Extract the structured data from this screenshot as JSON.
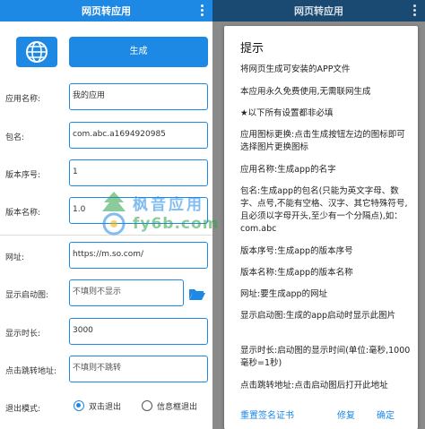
{
  "app": {
    "title": "网页转应用"
  },
  "form": {
    "generate_label": "生成",
    "app_name": {
      "label": "应用名称:",
      "value": "我的应用"
    },
    "package": {
      "label": "包名:",
      "value": "com.abc.a1694920985"
    },
    "version_code": {
      "label": "版本序号:",
      "value": "1"
    },
    "version_name": {
      "label": "版本名称:",
      "value": "1.0"
    },
    "url": {
      "label": "网址:",
      "value": "https://m.so.com/"
    },
    "splash": {
      "label": "显示启动图:",
      "value": "不填则不显示"
    },
    "duration": {
      "label": "显示时长:",
      "value": "3000"
    },
    "click_url": {
      "label": "点击跳转地址:",
      "value": "不填则不跳转"
    },
    "exit": {
      "label": "退出模式:",
      "options": [
        "双击退出",
        "信息框退出"
      ],
      "selected": "双击退出"
    }
  },
  "dialog": {
    "title": "提示",
    "paragraphs": [
      "将网页生成可安装的APP文件",
      "本应用永久免费使用,无需联网生成",
      "★以下所有设置都非必填",
      "应用图标更换:点击生成按钮左边的图标即可选择图片更换图标",
      "应用名称:生成app的名字",
      "包名:生成app的包名(只能为英文字母、数字、点号,不能有空格、汉字、其它特殊符号,且必须以字母开头,至少有一个分隔点),如：com.abc",
      "版本序号:生成app的版本序号",
      "版本名称:生成app的版本名称",
      "网址:要生成app的网址",
      "显示启动图:生成的app启动时显示此图片",
      "显示时长:启动图的显示时间(单位:毫秒,1000毫秒=1秒)",
      "点击跳转地址:点击启动图后打开此地址"
    ],
    "actions": {
      "reset": "重置签名证书",
      "repair": "修复",
      "confirm": "确定"
    }
  },
  "watermark": {
    "text_cn": "枫音应用",
    "text_en": "fy6b.com"
  },
  "colors": {
    "primary": "#1e88e5",
    "dim_bar": "#1a4a72",
    "overlay": "#8a8a8a"
  },
  "icons": [
    "globe-icon",
    "more-vert-icon",
    "folder-open-icon",
    "watermark-logo-icon"
  ]
}
